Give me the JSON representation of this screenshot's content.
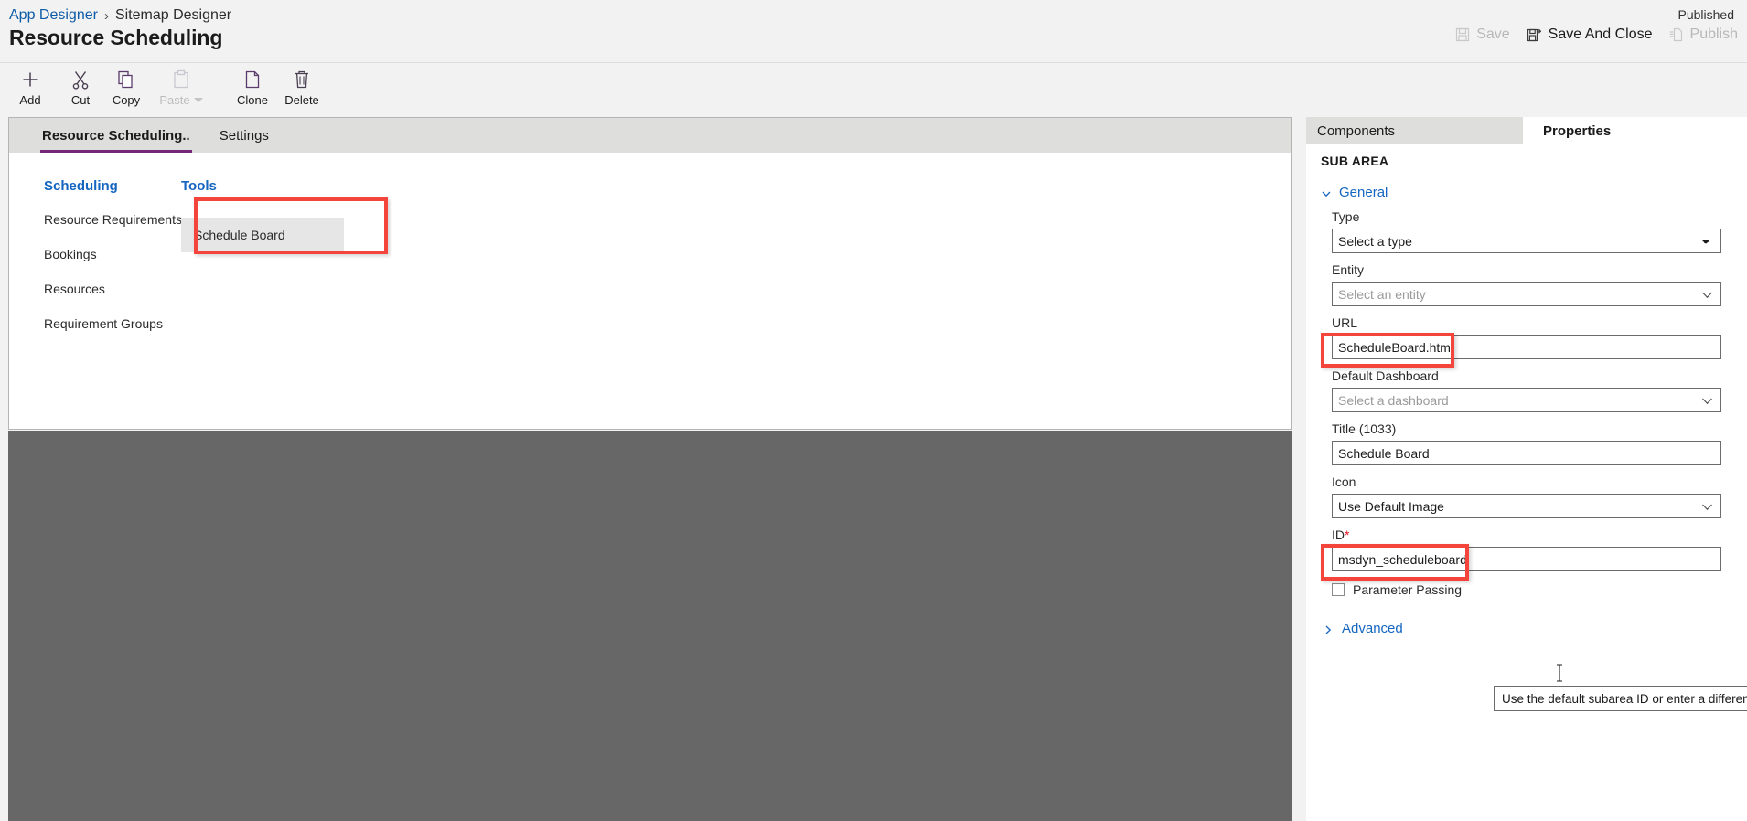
{
  "header": {
    "breadcrumb": [
      "App Designer",
      "Sitemap Designer"
    ],
    "breadcrumb_separator": "›",
    "title": "Resource Scheduling",
    "status": "Published",
    "actions": [
      {
        "label": "Save",
        "icon": "save-icon",
        "disabled": true
      },
      {
        "label": "Save And Close",
        "icon": "save-and-close-icon",
        "disabled": false
      },
      {
        "label": "Publish",
        "icon": "publish-icon",
        "disabled": true
      }
    ]
  },
  "commandbar": {
    "items": [
      {
        "label": "Add",
        "icon": "plus-icon",
        "disabled": false
      },
      {
        "label": "Cut",
        "icon": "scissors-icon",
        "disabled": false
      },
      {
        "label": "Copy",
        "icon": "copy-icon",
        "disabled": false
      },
      {
        "label": "Paste",
        "icon": "clipboard-icon",
        "disabled": true,
        "has_caret": true
      },
      {
        "label": "Clone",
        "icon": "clone-icon",
        "disabled": false
      },
      {
        "label": "Delete",
        "icon": "trash-icon",
        "disabled": false
      }
    ]
  },
  "designer": {
    "tabs": [
      {
        "label": "Resource Scheduling..",
        "active": true
      },
      {
        "label": "Settings",
        "active": false
      }
    ],
    "groups": [
      {
        "title": "Scheduling",
        "items": [
          "Resource Requirements",
          "Bookings",
          "Resources",
          "Requirement Groups"
        ]
      },
      {
        "title": "Tools",
        "items": [
          "Schedule Board"
        ]
      }
    ],
    "selected_tile": "Schedule Board"
  },
  "properties_panel": {
    "tabs": [
      {
        "label": "Components",
        "active": false
      },
      {
        "label": "Properties",
        "active": true
      }
    ],
    "heading": "SUB AREA",
    "general_section": {
      "label": "General",
      "expanded": true
    },
    "fields": {
      "type": {
        "label": "Type",
        "value": "Select a type",
        "control": "select"
      },
      "entity": {
        "label": "Entity",
        "value": "",
        "placeholder": "Select an entity",
        "control": "combo"
      },
      "url": {
        "label": "URL",
        "value": "ScheduleBoard.html",
        "control": "text"
      },
      "default_dashboard": {
        "label": "Default Dashboard",
        "value": "",
        "placeholder": "Select a dashboard",
        "control": "combo"
      },
      "title": {
        "label": "Title (1033)",
        "value": "Schedule Board",
        "control": "text"
      },
      "icon": {
        "label": "Icon",
        "value": "Use Default Image",
        "control": "combo"
      },
      "id": {
        "label": "ID",
        "required_marker": "*",
        "value": "msdyn_scheduleboard",
        "control": "text"
      },
      "parameter_passing": {
        "label": "Parameter Passing",
        "checked": false,
        "control": "checkbox"
      }
    },
    "advanced_section": {
      "label": "Advanced",
      "expanded": false
    },
    "tooltip": "Use the default subarea ID or enter a different one."
  },
  "colors": {
    "accent_link": "#1566c0",
    "tab_underline": "#742774",
    "annotation": "#f4453c",
    "required": "#e81123",
    "scrim": "#676767",
    "page_bg": "#f2f2f2"
  }
}
